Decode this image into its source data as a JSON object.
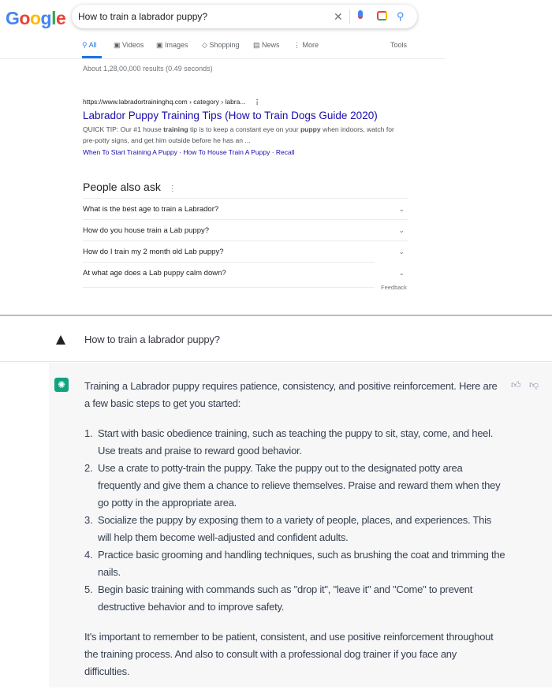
{
  "google": {
    "logo": "Google",
    "logo_colors": [
      "#4285f4",
      "#ea4335",
      "#fbbc05",
      "#4285f4",
      "#34a853",
      "#ea4335"
    ],
    "search_query": "How to train a labrador puppy?",
    "icons": [
      "close-icon",
      "microphone-icon",
      "lens-camera-icon",
      "search-icon"
    ],
    "tabs": [
      {
        "label": "All",
        "icon": "search-icon",
        "active": true
      },
      {
        "label": "Videos",
        "icon": "play-icon"
      },
      {
        "label": "Images",
        "icon": "image-icon"
      },
      {
        "label": "Shopping",
        "icon": "tag-icon"
      },
      {
        "label": "News",
        "icon": "newspaper-icon"
      },
      {
        "label": "More",
        "icon": "more-vert-icon"
      }
    ],
    "tools_label": "Tools",
    "result_stats": "About 1,28,00,000 results (0.49 seconds)",
    "result": {
      "url": "https://www.labradortraininghq.com › category › labra...",
      "title": "Labrador Puppy Training Tips (How to Train Dogs Guide 2020)",
      "snippet_parts": [
        "QUICK TIP: Our #1 house ",
        "training",
        " tip is to keep a constant eye on your ",
        "puppy",
        " when indoors, watch for pre-potty signs, and get him outside before he has an ..."
      ],
      "sitelinks": [
        "When To Start Training A Puppy",
        "How To House Train A Puppy",
        "Recall"
      ]
    },
    "people_also_ask": {
      "title": "People also ask",
      "questions": [
        "What is the best age to train a Labrador?",
        "How do you house train a Lab puppy?",
        "How do I train my 2 month old Lab puppy?",
        "At what age does a Lab puppy calm down?"
      ],
      "feedback": "Feedback"
    }
  },
  "chat": {
    "user_message": "How to train a labrador puppy?",
    "assistant": {
      "intro": "Training a Labrador puppy requires patience, consistency, and positive reinforcement. Here are a few basic steps to get you started:",
      "steps": [
        {
          "num": "1.",
          "text": "Start with basic obedience training, such as teaching the puppy to sit, stay, come, and heel. Use treats and praise to reward good behavior."
        },
        {
          "num": "2.",
          "text": "Use a crate to potty-train the puppy. Take the puppy out to the designated potty area frequently and give them a chance to relieve themselves. Praise and reward them when they go potty in the appropriate area."
        },
        {
          "num": "3.",
          "text": "Socialize the puppy by exposing them to a variety of people, places, and experiences. This will help them become well-adjusted and confident adults."
        },
        {
          "num": "4.",
          "text": "Practice basic grooming and handling techniques, such as brushing the coat and trimming the nails."
        },
        {
          "num": "5.",
          "text": "Begin basic training with commands such as \"drop it\", \"leave it\" and \"Come\" to prevent destructive behavior and to improve safety."
        }
      ],
      "outro": "It's important to remember to be patient, consistent, and use positive reinforcement throughout the training process. And also to consult with a professional dog trainer if you face any difficulties."
    },
    "accent": "#10a37f"
  }
}
